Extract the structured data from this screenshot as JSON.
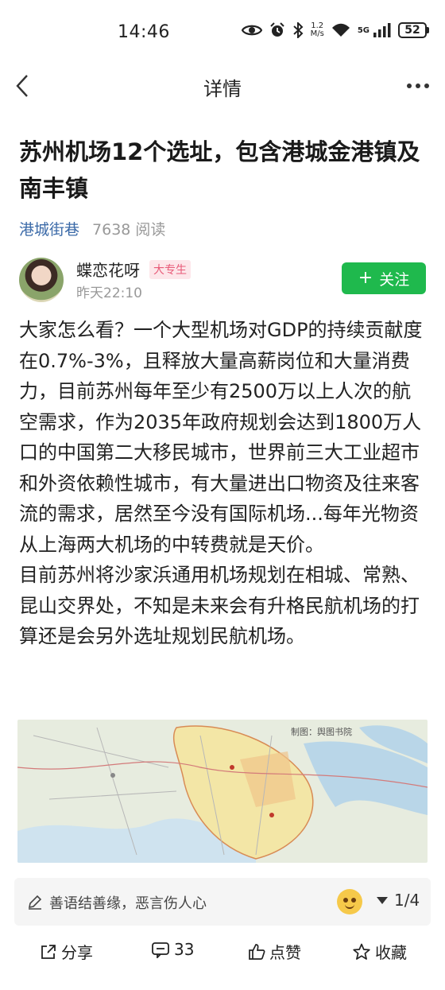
{
  "status_bar": {
    "time": "14:46",
    "net_speed_value": "1.2",
    "net_speed_unit": "M/s",
    "network": "5G",
    "battery": "52",
    "icons": [
      "eye-icon",
      "alarm-icon",
      "bluetooth-icon",
      "wifi-icon",
      "signal-icon",
      "battery-icon"
    ]
  },
  "nav": {
    "title": "详情",
    "back_icon": "chevron-left-icon",
    "more_icon": "more-dots-icon"
  },
  "article": {
    "title": "苏州机场12个选址，包含港城金港镇及南丰镇",
    "source": "港城街巷",
    "reads": "7638 阅读",
    "author": {
      "name": "蝶恋花呀",
      "badge": "大专生",
      "time": "昨天22:10",
      "follow_label": "关注"
    },
    "paragraphs": [
      "大家怎么看？一个大型机场对GDP的持续贡献度在0.7%-3%，且释放大量高薪岗位和大量消费力，目前苏州每年至少有2500万以上人次的航空需求，作为2035年政府规划会达到1800万人口的中国第二大移民城市，世界前三大工业超市和外资依赖性城市，有大量进出口物资及往来客流的需求，居然至今没有国际机场...每年光物资从上海两大机场的中转费就是天价。",
      "目前苏州将沙家浜通用机场规划在相城、常熟、昆山交界处，不知是未来会有升格民航机场的打算还是会另外选址规划民航机场。"
    ],
    "image_credit": "制图：舆图书院"
  },
  "comment_bar": {
    "placeholder": "善语结善缘，恶言伤人心",
    "page_indicator": "1/4"
  },
  "actions": {
    "share": "分享",
    "comments": "33",
    "like": "点赞",
    "favorite": "收藏"
  },
  "colors": {
    "follow_green": "#1fb94d",
    "source_blue": "#3b6aa8",
    "badge_pink": "#e85a78"
  }
}
